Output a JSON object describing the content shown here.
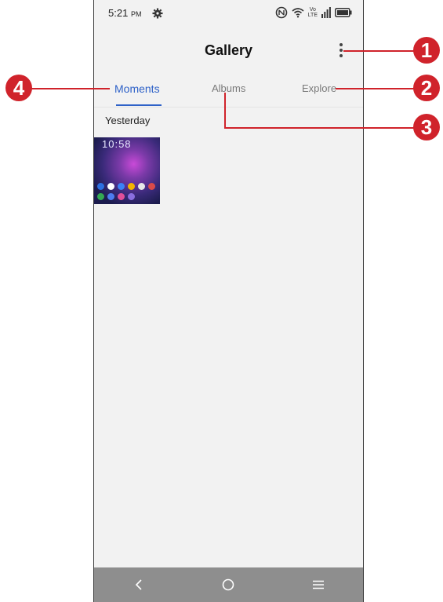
{
  "status": {
    "time": "5:21",
    "ampm": "PM",
    "volte": "Vo",
    "lte": "LTE"
  },
  "app": {
    "title": "Gallery"
  },
  "tabs": [
    {
      "label": "Moments",
      "active": true
    },
    {
      "label": "Albums",
      "active": false
    },
    {
      "label": "Explore",
      "active": false
    }
  ],
  "moments": {
    "section_label": "Yesterday",
    "thumb_clock": "10:58"
  },
  "callouts": [
    "1",
    "2",
    "3",
    "4"
  ],
  "colors": {
    "accent": "#2f62c8",
    "callout": "#d0232b",
    "navbar": "#8e8e8e",
    "background": "#f2f2f2"
  },
  "icons": [
    "settings-gear-icon",
    "nfc-icon",
    "wifi-icon",
    "signal-icon",
    "battery-icon",
    "more-vert-icon",
    "back-icon",
    "home-icon",
    "recents-icon"
  ]
}
